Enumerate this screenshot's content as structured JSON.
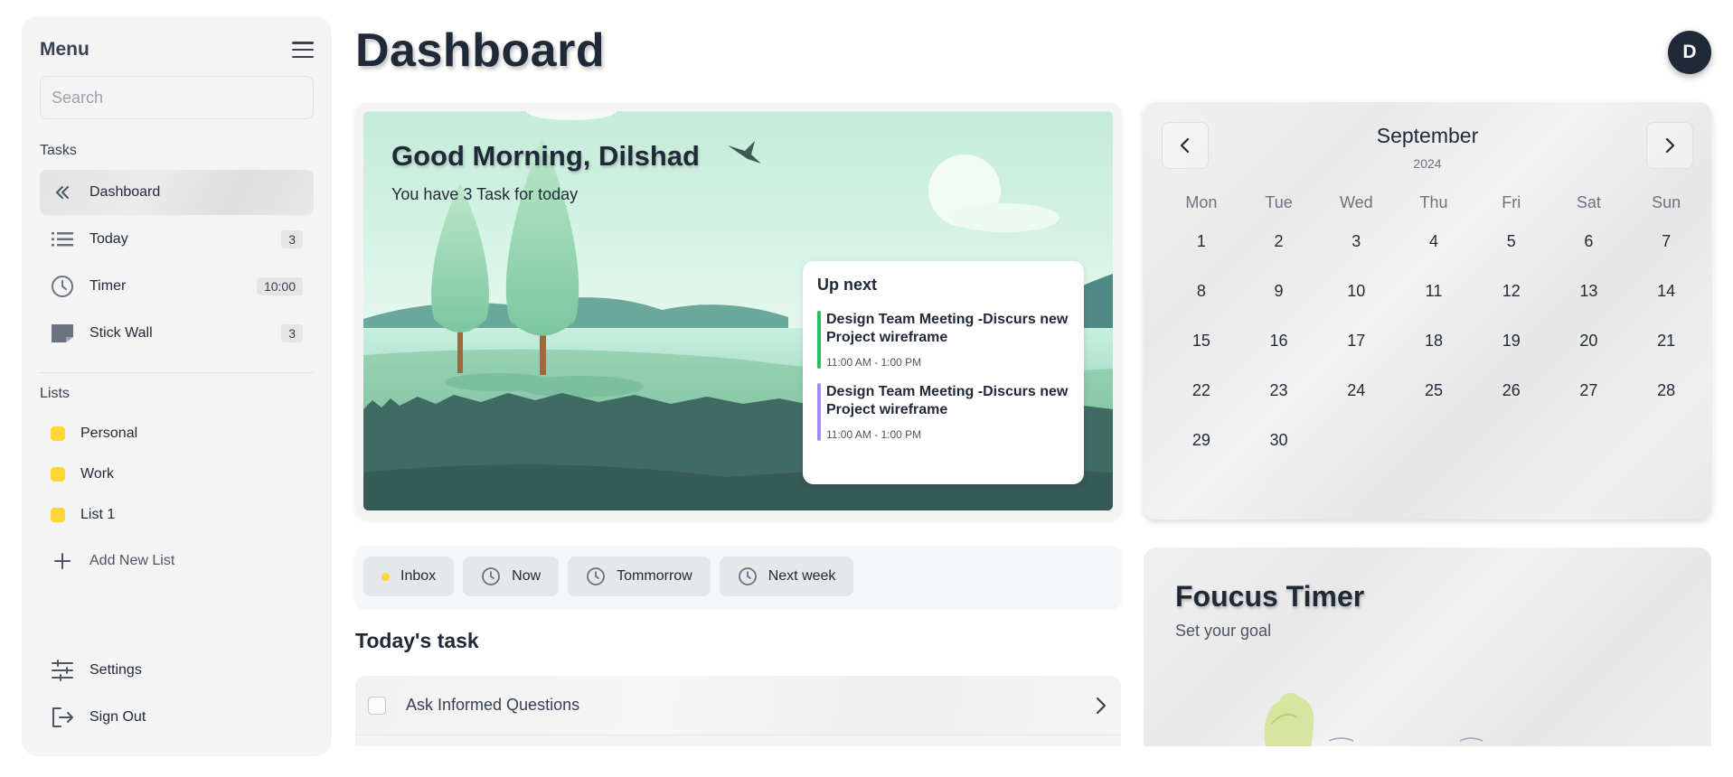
{
  "sidebar": {
    "title": "Menu",
    "search_placeholder": "Search",
    "tasks_label": "Tasks",
    "items": [
      {
        "label": "Dashboard",
        "icon": "double-chevron-left-icon",
        "badge": ""
      },
      {
        "label": "Today",
        "icon": "list-icon",
        "badge": "3"
      },
      {
        "label": "Timer",
        "icon": "clock-icon",
        "badge": "10:00"
      },
      {
        "label": "Stick Wall",
        "icon": "sticky-note-icon",
        "badge": "3"
      }
    ],
    "lists_label": "Lists",
    "lists": [
      {
        "label": "Personal",
        "color": "#fcd735"
      },
      {
        "label": "Work",
        "color": "#fcd735"
      },
      {
        "label": "List 1",
        "color": "#fcd735"
      }
    ],
    "add_list_label": "Add New List",
    "settings_label": "Settings",
    "signout_label": "Sign Out"
  },
  "header": {
    "title": "Dashboard",
    "avatar_initial": "D"
  },
  "hero": {
    "greeting": "Good Morning, Dilshad",
    "subtitle": "You have 3 Task for today",
    "up_next_title": "Up next",
    "events": [
      {
        "title": "Design Team Meeting -Discurs new Project wireframe",
        "time": "11:00 AM - 1:00 PM",
        "color": "#22c55e"
      },
      {
        "title": "Design Team Meeting -Discurs new Project wireframe",
        "time": "11:00 AM - 1:00 PM",
        "color": "#a78bfa"
      }
    ]
  },
  "filters": [
    {
      "label": "Inbox"
    },
    {
      "label": "Now"
    },
    {
      "label": "Tommorrow"
    },
    {
      "label": "Next week"
    }
  ],
  "today_tasks": {
    "title": "Today's task",
    "items": [
      {
        "label": "Ask Informed Questions",
        "done": false
      }
    ]
  },
  "calendar": {
    "month": "September",
    "year": "2024",
    "weekdays": [
      "Mon",
      "Tue",
      "Wed",
      "Thu",
      "Fri",
      "Sat",
      "Sun"
    ],
    "days": [
      "1",
      "2",
      "3",
      "4",
      "5",
      "6",
      "7",
      "8",
      "9",
      "10",
      "11",
      "12",
      "13",
      "14",
      "15",
      "16",
      "17",
      "18",
      "19",
      "20",
      "21",
      "22",
      "23",
      "24",
      "25",
      "26",
      "27",
      "28",
      "29",
      "30"
    ]
  },
  "focus": {
    "title": "Foucus Timer",
    "subtitle": "Set your goal"
  }
}
